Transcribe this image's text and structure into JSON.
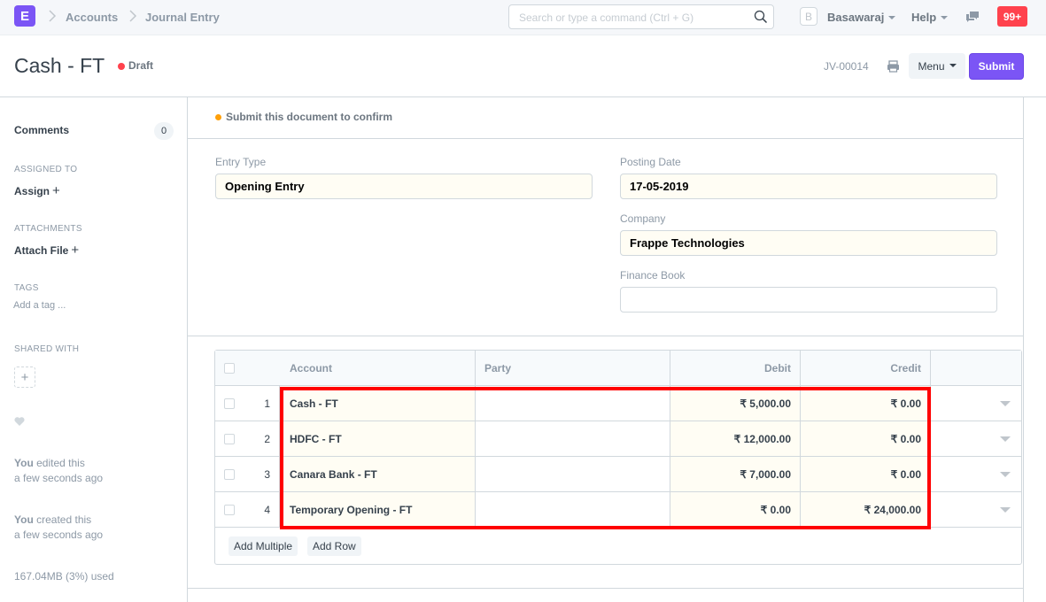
{
  "navbar": {
    "logo_letter": "E",
    "breadcrumbs": [
      "Accounts",
      "Journal Entry"
    ],
    "search_placeholder": "Search or type a command (Ctrl + G)",
    "user_initial": "B",
    "user_name": "Basawaraj",
    "help_label": "Help",
    "notification_count": "99+",
    "colors": {
      "brand": "#7b55f5",
      "notification": "#ff424d"
    }
  },
  "page_head": {
    "title": "Cash - FT",
    "status": "Draft",
    "status_color": "#ff424d",
    "doc_id": "JV-00014",
    "menu_label": "Menu",
    "submit_label": "Submit"
  },
  "sidebar": {
    "comments_label": "Comments",
    "comments_count": "0",
    "assigned_to_label": "ASSIGNED TO",
    "assign_action": "Assign",
    "attachments_label": "ATTACHMENTS",
    "attach_action": "Attach File",
    "tags_label": "TAGS",
    "add_tag_placeholder": "Add a tag ...",
    "shared_with_label": "SHARED WITH",
    "activity": [
      {
        "actor": "You",
        "action": "edited this",
        "time": "a few seconds ago"
      },
      {
        "actor": "You",
        "action": "created this",
        "time": "a few seconds ago"
      }
    ],
    "usage": "167.04MB (3%) used"
  },
  "main": {
    "message": "Submit this document to confirm",
    "message_color": "#ffa00a",
    "fields": {
      "entry_type": {
        "label": "Entry Type",
        "value": "Opening Entry"
      },
      "posting_date": {
        "label": "Posting Date",
        "value": "17-05-2019"
      },
      "company": {
        "label": "Company",
        "value": "Frappe Technologies"
      },
      "finance_book": {
        "label": "Finance Book",
        "value": ""
      }
    },
    "grid": {
      "columns": [
        "Account",
        "Party",
        "Debit",
        "Credit"
      ],
      "rows": [
        {
          "idx": "1",
          "account": "Cash - FT",
          "party": "",
          "debit": "₹ 5,000.00",
          "credit": "₹ 0.00"
        },
        {
          "idx": "2",
          "account": "HDFC - FT",
          "party": "",
          "debit": "₹ 12,000.00",
          "credit": "₹ 0.00"
        },
        {
          "idx": "3",
          "account": "Canara Bank - FT",
          "party": "",
          "debit": "₹ 7,000.00",
          "credit": "₹ 0.00"
        },
        {
          "idx": "4",
          "account": "Temporary Opening - FT",
          "party": "",
          "debit": "₹ 0.00",
          "credit": "₹ 24,000.00"
        }
      ],
      "add_multiple_label": "Add Multiple",
      "add_row_label": "Add Row"
    }
  }
}
